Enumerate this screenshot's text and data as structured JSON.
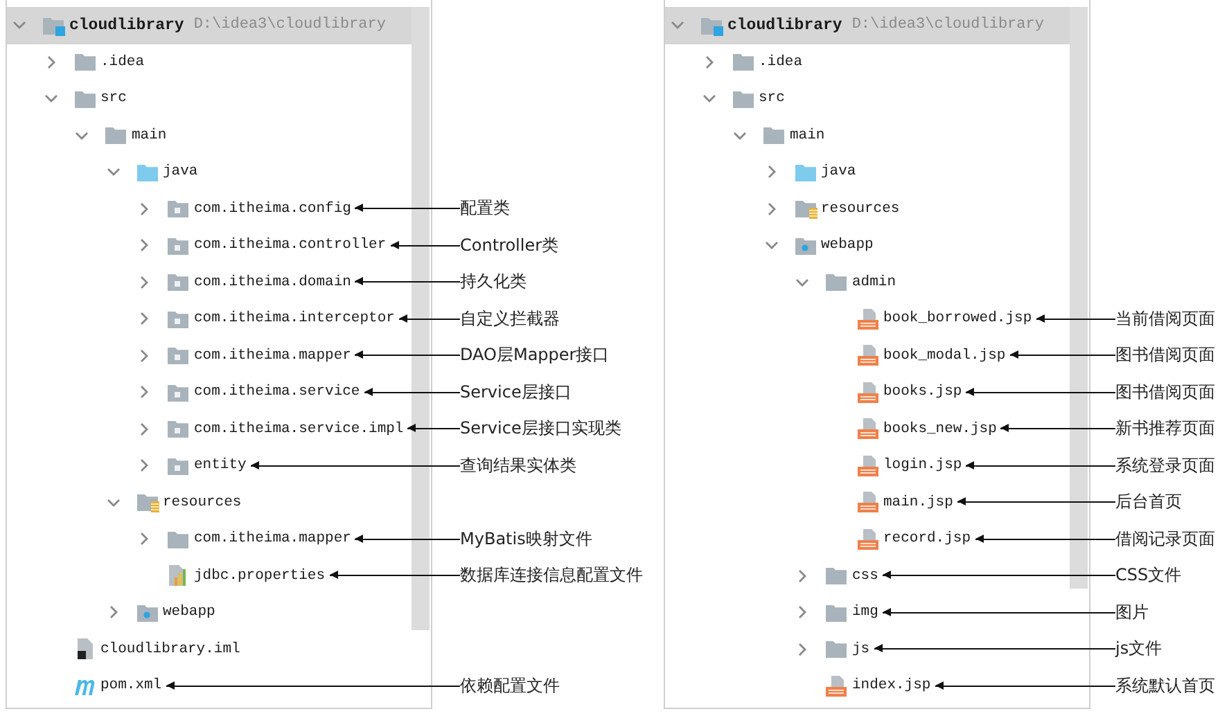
{
  "panels": [
    {
      "tree": [
        {
          "name": "cloudlibrary",
          "path": "D:\\idea3\\cloudlibrary",
          "kind": "module",
          "expanded": true,
          "selected": true,
          "children": [
            {
              "name": ".idea",
              "kind": "folder",
              "expanded": false,
              "selected": false
            },
            {
              "name": "src",
              "kind": "folder",
              "expanded": true,
              "selected": false,
              "children": [
                {
                  "name": "main",
                  "kind": "folder",
                  "expanded": true,
                  "selected": false,
                  "children": [
                    {
                      "name": "java",
                      "kind": "source",
                      "expanded": true,
                      "selected": false,
                      "children": [
                        {
                          "name": "com.itheima.config",
                          "kind": "package",
                          "expanded": false,
                          "selected": false,
                          "note": "配置类"
                        },
                        {
                          "name": "com.itheima.controller",
                          "kind": "package",
                          "expanded": false,
                          "selected": false,
                          "note": "Controller类"
                        },
                        {
                          "name": "com.itheima.domain",
                          "kind": "package",
                          "expanded": false,
                          "selected": false,
                          "note": "持久化类"
                        },
                        {
                          "name": "com.itheima.interceptor",
                          "kind": "package",
                          "expanded": false,
                          "selected": false,
                          "note": "自定义拦截器"
                        },
                        {
                          "name": "com.itheima.mapper",
                          "kind": "package",
                          "expanded": false,
                          "selected": false,
                          "note": "DAO层Mapper接口"
                        },
                        {
                          "name": "com.itheima.service",
                          "kind": "package",
                          "expanded": false,
                          "selected": false,
                          "note": "Service层接口"
                        },
                        {
                          "name": "com.itheima.service.impl",
                          "kind": "package",
                          "expanded": false,
                          "selected": false,
                          "note": "Service层接口实现类"
                        },
                        {
                          "name": "entity",
                          "kind": "package",
                          "expanded": false,
                          "selected": false,
                          "note": "查询结果实体类"
                        }
                      ]
                    },
                    {
                      "name": "resources",
                      "kind": "resources",
                      "expanded": true,
                      "selected": false,
                      "children": [
                        {
                          "name": "com.itheima.mapper",
                          "kind": "folder",
                          "expanded": false,
                          "selected": false,
                          "note": "MyBatis映射文件"
                        },
                        {
                          "name": "jdbc.properties",
                          "kind": "properties",
                          "selected": false,
                          "note": "数据库连接信息配置文件"
                        }
                      ]
                    },
                    {
                      "name": "webapp",
                      "kind": "webapp",
                      "expanded": false,
                      "selected": false
                    }
                  ]
                }
              ]
            },
            {
              "name": "cloudlibrary.iml",
              "kind": "iml",
              "selected": false
            },
            {
              "name": "pom.xml",
              "kind": "maven",
              "selected": false,
              "note": "依赖配置文件"
            }
          ]
        }
      ]
    },
    {
      "tree": [
        {
          "name": "cloudlibrary",
          "path": "D:\\idea3\\cloudlibrary",
          "kind": "module",
          "expanded": true,
          "selected": true,
          "children": [
            {
              "name": ".idea",
              "kind": "folder",
              "expanded": false,
              "selected": false
            },
            {
              "name": "src",
              "kind": "folder",
              "expanded": true,
              "selected": false,
              "children": [
                {
                  "name": "main",
                  "kind": "folder",
                  "expanded": true,
                  "selected": false,
                  "children": [
                    {
                      "name": "java",
                      "kind": "source",
                      "expanded": false,
                      "selected": false
                    },
                    {
                      "name": "resources",
                      "kind": "resources",
                      "expanded": false,
                      "selected": false
                    },
                    {
                      "name": "webapp",
                      "kind": "webapp",
                      "expanded": true,
                      "selected": false,
                      "children": [
                        {
                          "name": "admin",
                          "kind": "folder",
                          "expanded": true,
                          "selected": false,
                          "children": [
                            {
                              "name": "book_borrowed.jsp",
                              "kind": "jsp",
                              "selected": false,
                              "note": "当前借阅页面"
                            },
                            {
                              "name": "book_modal.jsp",
                              "kind": "jsp",
                              "selected": false,
                              "note": "图书借阅页面"
                            },
                            {
                              "name": "books.jsp",
                              "kind": "jsp",
                              "selected": false,
                              "note": "图书借阅页面"
                            },
                            {
                              "name": "books_new.jsp",
                              "kind": "jsp",
                              "selected": false,
                              "note": "新书推荐页面"
                            },
                            {
                              "name": "login.jsp",
                              "kind": "jsp",
                              "selected": false,
                              "note": "系统登录页面"
                            },
                            {
                              "name": "main.jsp",
                              "kind": "jsp",
                              "selected": false,
                              "note": "后台首页"
                            },
                            {
                              "name": "record.jsp",
                              "kind": "jsp",
                              "selected": false,
                              "note": "借阅记录页面"
                            }
                          ]
                        },
                        {
                          "name": "css",
                          "kind": "folder",
                          "expanded": false,
                          "selected": false,
                          "note": "CSS文件"
                        },
                        {
                          "name": "img",
                          "kind": "folder",
                          "expanded": false,
                          "selected": false,
                          "note": "图片"
                        },
                        {
                          "name": "js",
                          "kind": "folder",
                          "expanded": false,
                          "selected": false,
                          "note": "js文件"
                        },
                        {
                          "name": "index.jsp",
                          "kind": "jsp",
                          "selected": false,
                          "note": "系统默认首页"
                        }
                      ]
                    }
                  ]
                }
              ]
            }
          ]
        }
      ]
    }
  ]
}
